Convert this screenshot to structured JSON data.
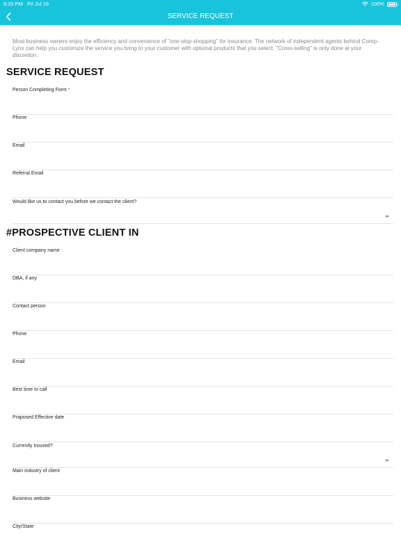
{
  "status": {
    "time": "6:20 PM",
    "date": "Fri Jul 19",
    "battery": "100%"
  },
  "nav": {
    "title": "SERVICE REQUEST"
  },
  "intro": "Most business owners enjoy the efficiency and convenience of \"one-stop-shopping\" for insurance. The network of independent agents behind Comp-Lynx can help you customize the service you bring to your customer with optional products that you select. \"Cross-selling\" is only done at your discretion.",
  "sections": {
    "service_request": {
      "heading": "SERVICE REQUEST"
    },
    "prospective": {
      "heading": "#PROSPECTIVE CLIENT IN"
    }
  },
  "fields": {
    "person_completing": {
      "label": "Person Completing Form",
      "required_mark": "*"
    },
    "phone": {
      "label": "Phone"
    },
    "email": {
      "label": "Email"
    },
    "referral_email": {
      "label": "Referral Email"
    },
    "contact_before": {
      "label": "Would like us to contact you before we contact the client?"
    },
    "client_company": {
      "label": "Client company name"
    },
    "dba": {
      "label": "DBA, if any"
    },
    "contact_person": {
      "label": "Contact person"
    },
    "client_phone": {
      "label": "Phone"
    },
    "client_email": {
      "label": "Email"
    },
    "best_time": {
      "label": "Best time to call"
    },
    "effective_date": {
      "label": "Praposed Effective date"
    },
    "currently_insured": {
      "label": "Currently Insured?"
    },
    "main_industry": {
      "label": "Main industry of client"
    },
    "business_website": {
      "label": "Business website"
    },
    "city_state": {
      "label": "City/State"
    }
  },
  "colors": {
    "header": "#19c3db",
    "required": "#d9342b",
    "intro_text": "#8a8a8a"
  },
  "icons": {
    "back": "chevron-left-icon",
    "wifi": "wifi-icon",
    "battery": "battery-icon",
    "dropdown": "chevron-down-icon"
  }
}
